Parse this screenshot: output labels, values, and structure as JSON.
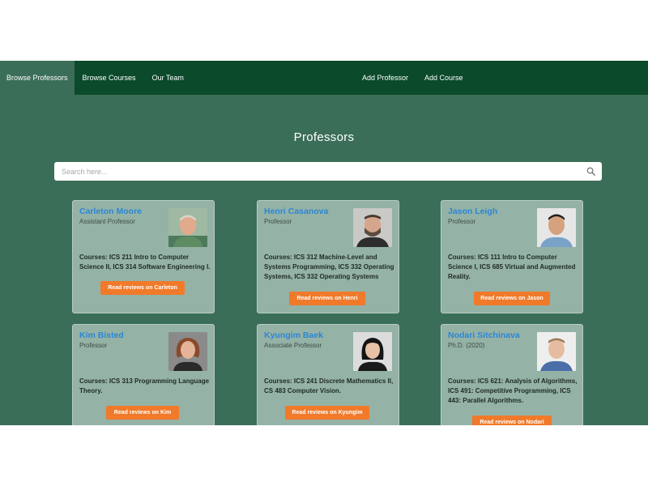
{
  "nav": {
    "left": [
      "Browse Professors",
      "Browse Courses",
      "Our Team"
    ],
    "right": [
      "Add Professor",
      "Add Course"
    ]
  },
  "main": {
    "heading": "Professors",
    "search_placeholder": "Search here..."
  },
  "professors": [
    {
      "name": "Carleton Moore",
      "title": "Assistant Professor",
      "courses": "Courses: ICS 211 Intro to Computer Science II, ICS 314 Software Engineering I.",
      "button": "Read reviews on Carleton"
    },
    {
      "name": "Henri Casanova",
      "title": "Professor",
      "courses": "Courses: ICS 312 Machine-Level and Systems Programming, ICS 332 Operating Systems, ICS 332 Operating Systems",
      "button": "Read reviews on Henri"
    },
    {
      "name": "Jason Leigh",
      "title": "Professor",
      "courses": "Courses: ICS 111 Intro to Computer Science I, ICS 685 Virtual and Augmented Reality.",
      "button": "Read reviews on Jason"
    },
    {
      "name": "Kim Bisted",
      "title": "Professor",
      "courses": "Courses: ICS 313 Programming Language Theory.",
      "button": "Read reviews on Kim"
    },
    {
      "name": "Kyungim Baek",
      "title": "Associate Professor",
      "courses": "Courses: ICS 241 Discrete Mathematics II, CS 483 Computer Vision.",
      "button": "Read reviews on Kyungim"
    },
    {
      "name": "Nodari Sitchinava",
      "title": "Ph.D. (2020)",
      "courses": "Courses: ICS 621: Analysis of Algorithms, ICS 491: Competitive Programming, ICS 443: Parallel Algorithms.",
      "button": "Read reviews on Nodari"
    }
  ],
  "colors": {
    "navbar": "#0b4a2b",
    "page": "#3b6e58",
    "card": "#94b2a6",
    "name_link": "#2c86d6",
    "button": "#f07a2a"
  },
  "icons": {
    "search": "search-icon"
  }
}
